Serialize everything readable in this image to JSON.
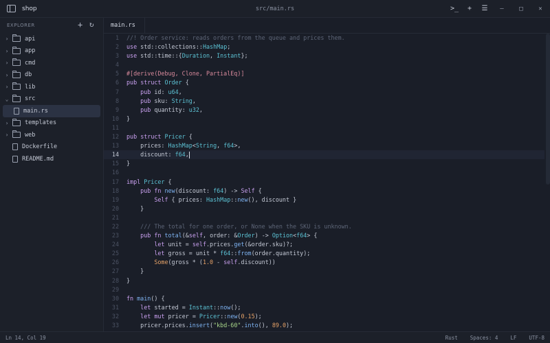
{
  "app": {
    "name": "shop",
    "window_title": "src/main.rs"
  },
  "titlebar": {
    "icons": [
      "terminal-icon",
      "plus-icon",
      "sliders-icon",
      "minimize-icon",
      "maximize-icon",
      "close-icon"
    ]
  },
  "explorer": {
    "title": "EXPLORER",
    "items": [
      {
        "label": "api",
        "type": "folder",
        "expanded": false
      },
      {
        "label": "app",
        "type": "folder",
        "expanded": false
      },
      {
        "label": "cmd",
        "type": "folder",
        "expanded": false
      },
      {
        "label": "db",
        "type": "folder",
        "expanded": false
      },
      {
        "label": "lib",
        "type": "folder",
        "expanded": false
      },
      {
        "label": "src",
        "type": "folder",
        "expanded": true
      },
      {
        "label": "main.rs",
        "type": "file",
        "active": true
      },
      {
        "label": "templates",
        "type": "folder",
        "expanded": false
      },
      {
        "label": "web",
        "type": "folder",
        "expanded": false
      },
      {
        "label": "Dockerfile",
        "type": "file"
      },
      {
        "label": "README.md",
        "type": "file"
      }
    ]
  },
  "tab": {
    "label": "main.rs"
  },
  "editor": {
    "current_line": 14,
    "lines": [
      "//! Order service: reads orders from the queue and prices them.",
      "use std::collections::HashMap;",
      "use std::time::{Duration, Instant};",
      "",
      "#[derive(Debug, Clone, PartialEq)]",
      "pub struct Order {",
      "    pub id: u64,",
      "    pub sku: String,",
      "    pub quantity: u32,",
      "}",
      "",
      "pub struct Pricer {",
      "    prices: HashMap<String, f64>,",
      "    discount: f64,",
      "}",
      "",
      "impl Pricer {",
      "    pub fn new(discount: f64) -> Self {",
      "        Self { prices: HashMap::new(), discount }",
      "    }",
      "",
      "    /// The total for one order, or None when the SKU is unknown.",
      "    pub fn total(&self, order: &Order) -> Option<f64> {",
      "        let unit = self.prices.get(&order.sku)?;",
      "        let gross = unit * f64::from(order.quantity);",
      "        Some(gross * (1.0 - self.discount))",
      "    }",
      "}",
      "",
      "fn main() {",
      "    let started = Instant::now();",
      "    let mut pricer = Pricer::new(0.15);",
      "    pricer.prices.insert(\"kbd-60\".into(), 89.0);"
    ]
  },
  "status": {
    "position": "Ln 14, Col 19",
    "language": "Rust",
    "indent": "Spaces: 4",
    "eol": "LF",
    "encoding": "UTF-8"
  }
}
